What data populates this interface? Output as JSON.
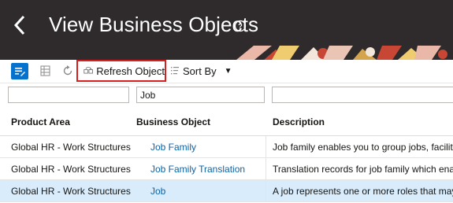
{
  "header": {
    "title": "View Business Objects",
    "back_icon": "chevron-left-icon",
    "help_icon": "help-circle-icon",
    "background": "#2f2b2c"
  },
  "toolbar": {
    "refresh_label": "Refresh Object",
    "sort_label": "Sort By",
    "accent": "#0572ce",
    "highlight": "#d6201f"
  },
  "filters": {
    "product_area": "",
    "business_object": "Job",
    "description": ""
  },
  "table": {
    "columns": [
      "Product Area",
      "Business Object",
      "Description"
    ],
    "rows": [
      {
        "product_area": "Global HR - Work Structures",
        "business_object": "Job Family",
        "description": "Job family enables you to group jobs, facilitat",
        "selected": false
      },
      {
        "product_area": "Global HR - Work Structures",
        "business_object": "Job Family Translation",
        "description": "Translation records for job family which enable",
        "selected": false
      },
      {
        "product_area": "Global HR - Work Structures",
        "business_object": "Job",
        "description": "A job represents one or more roles that may b",
        "selected": true
      }
    ]
  }
}
